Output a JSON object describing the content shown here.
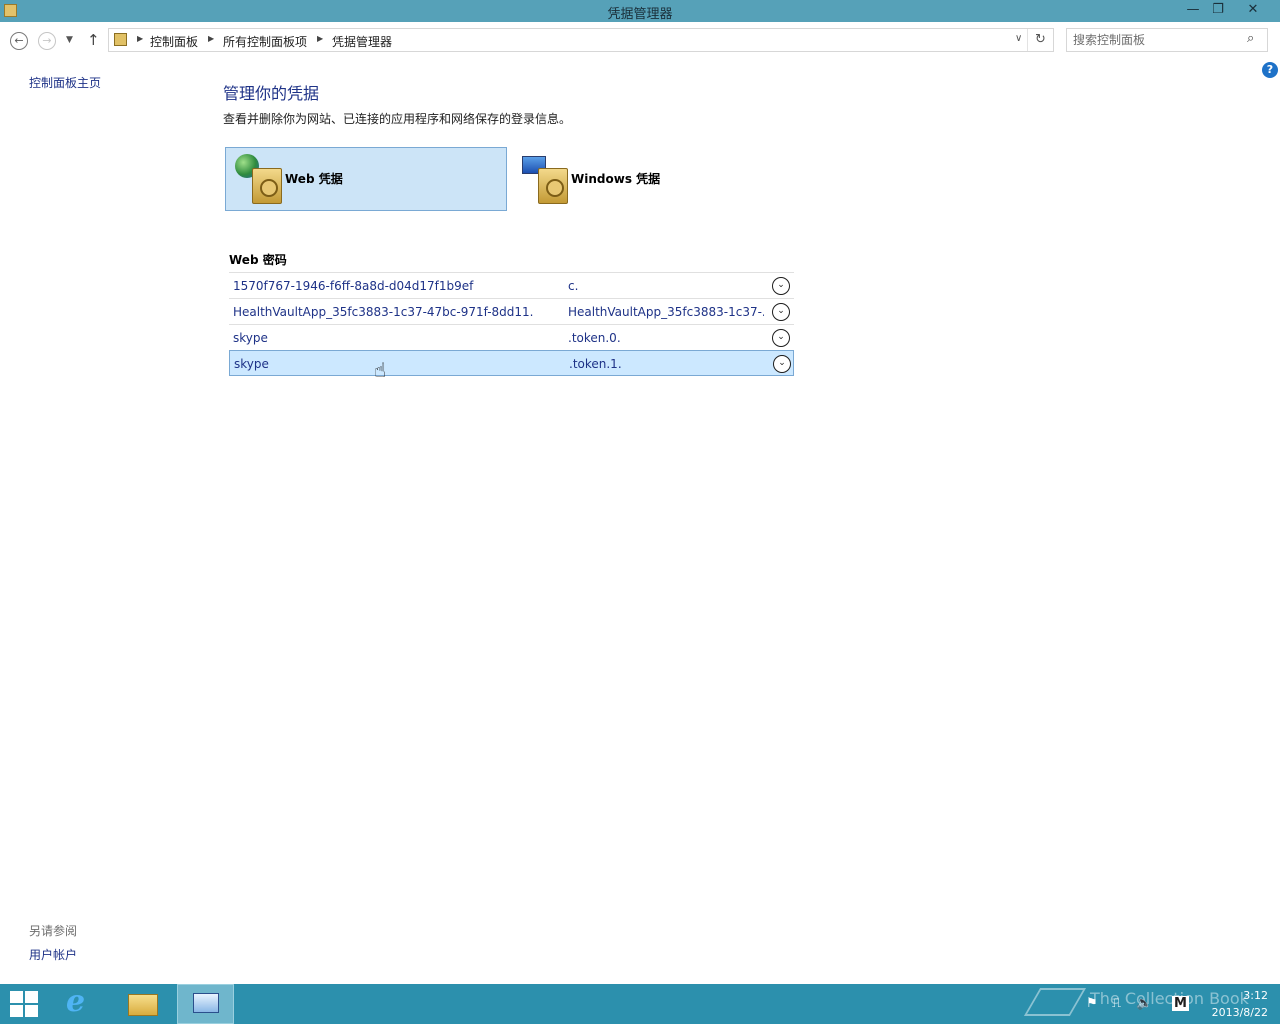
{
  "window": {
    "title": "凭据管理器",
    "minimize_glyph": "—",
    "maximize_glyph": "❐",
    "close_glyph": "✕"
  },
  "nav": {
    "back_glyph": "←",
    "forward_glyph": "→",
    "recent_glyph": "▼",
    "up_glyph": "↑",
    "breadcrumbs": [
      "控制面板",
      "所有控制面板项",
      "凭据管理器"
    ],
    "separator_glyph": "▶",
    "dropdown_glyph": "∨",
    "refresh_glyph": "↻",
    "search_placeholder": "搜索控制面板",
    "search_glyph": "⌕"
  },
  "left_pane": {
    "home_link": "控制面板主页",
    "see_also": "另请参阅",
    "user_accounts": "用户帐户"
  },
  "help_glyph": "?",
  "main": {
    "title": "管理你的凭据",
    "description": "查看并删除你为网站、已连接的应用程序和网络保存的登录信息。",
    "web_credentials_label": "Web 凭据",
    "windows_credentials_label": "Windows 凭据",
    "selected_type": "Web 凭据",
    "section_title": "Web 密码",
    "credentials": [
      {
        "address": "1570f767-1946-f6ff-8a8d-d04d17f1b9ef",
        "user": "c.",
        "selected": false
      },
      {
        "address": "HealthVaultApp_35fc3883-1c37-47bc-971f-8dd11...",
        "user": "HealthVaultApp_35fc3883-1c37-...",
        "selected": false
      },
      {
        "address": "skype",
        "user": ".token.0.",
        "selected": false
      },
      {
        "address": "skype",
        "user": ".token.1.",
        "selected": true
      }
    ],
    "expand_glyph": "⌄"
  },
  "taskbar": {
    "ie_glyph": "e",
    "clock_time": "3:12",
    "clock_date": "2013/8/22",
    "tray_glyphs": [
      "⚑",
      "⎍",
      "🔈",
      "M"
    ]
  },
  "watermark": "The Collection Book",
  "colors": {
    "titlebar": "#56a1b8",
    "taskbar": "#2c90ad",
    "link": "#1e3287",
    "selection": "#cce4f7"
  }
}
